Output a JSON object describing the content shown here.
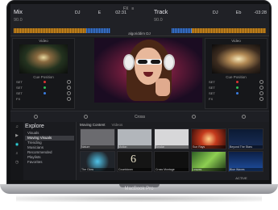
{
  "deck_left": {
    "title": "Mix",
    "label_dj": "DJ",
    "key": "E",
    "time": "02:31",
    "tempo": "90.0"
  },
  "deck_right": {
    "title": "Track",
    "label_dj": "DJ",
    "key": "Eb",
    "time": "-03:28",
    "tempo": "90.0"
  },
  "logo": "algoriddim DJ",
  "top_tools": [
    "FX",
    "≡"
  ],
  "video_left": {
    "header": "Video",
    "label": "Cue Position",
    "fx": [
      "SET",
      "SET",
      "SET",
      "FX"
    ]
  },
  "video_right": {
    "header": "Video",
    "label": "Cue Position",
    "fx": [
      "SET",
      "SET",
      "SET",
      "FX"
    ]
  },
  "mixer": {
    "crossfader_label": "Cross"
  },
  "browser": {
    "sidebar_icons": [
      "music-icon",
      "video-icon",
      "explore-icon",
      "search-icon",
      "history-icon"
    ],
    "explore_title": "Explore",
    "sections": [
      "Visuals",
      "Moving Visuals",
      "Trending",
      "Musicians",
      "Recommended",
      "Playlists",
      "Favorites"
    ],
    "selected_section": "Moving Visuals",
    "grid_header": "Moving Content",
    "grid_filter": "Videos",
    "tiles": [
      {
        "caption": "Nature",
        "color": "#6b6b6f"
      },
      {
        "caption": "Motion",
        "color": "#b2b6bb"
      },
      {
        "caption": "Smoke",
        "color": "#d7d7d9"
      },
      {
        "caption": "Sun Rays",
        "color": "#c43a1d"
      },
      {
        "caption": "Beyond The Stars",
        "color": "#1a2f5a"
      },
      {
        "caption": "The Glow",
        "color": "#20242a"
      },
      {
        "caption": "Countdown",
        "color": "#151515"
      },
      {
        "caption": "Cross Montage",
        "color": "#101010"
      },
      {
        "caption": "Leaves",
        "color": "#2e5f24"
      },
      {
        "caption": "Blue Waves",
        "color": "#1f4fa0"
      }
    ],
    "countdown_number": "6",
    "bottom_label": "ACTIVE"
  },
  "laptop_brand": "MacBook Pro"
}
